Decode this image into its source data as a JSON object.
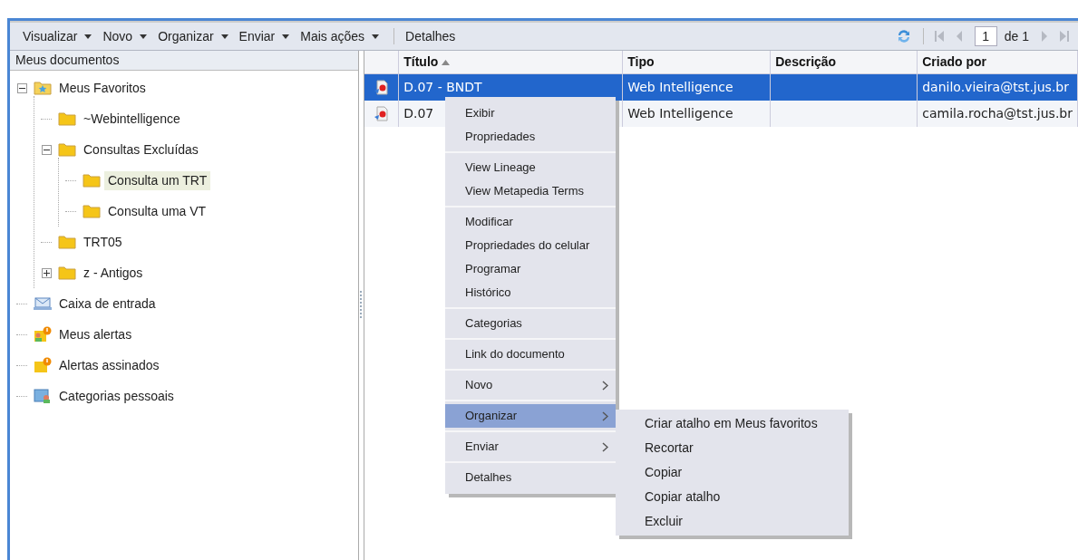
{
  "toolbar": {
    "menus": [
      {
        "label": "Visualizar",
        "dropdown": true
      },
      {
        "label": "Novo",
        "dropdown": true
      },
      {
        "label": "Organizar",
        "dropdown": true
      },
      {
        "label": "Enviar",
        "dropdown": true
      },
      {
        "label": "Mais ações",
        "dropdown": true
      },
      {
        "label": "Detalhes",
        "dropdown": false
      }
    ],
    "pager": {
      "page": "1",
      "of": "de 1"
    }
  },
  "sidebar": {
    "title": "Meus documentos",
    "items": [
      {
        "label": "Meus Favoritos",
        "kind": "favorites",
        "expanded": true,
        "selected": false,
        "children": [
          {
            "label": "~Webintelligence",
            "kind": "folder",
            "selected": false
          },
          {
            "label": "Consultas Excluídas",
            "kind": "folder",
            "expanded": true,
            "selected": false,
            "children": [
              {
                "label": "Consulta um TRT",
                "kind": "folder",
                "selected": true
              },
              {
                "label": "Consulta uma VT",
                "kind": "folder",
                "selected": false
              }
            ]
          },
          {
            "label": "TRT05",
            "kind": "folder",
            "selected": false
          },
          {
            "label": "z - Antigos",
            "kind": "folder",
            "expanded": false,
            "selected": false
          }
        ]
      },
      {
        "label": "Caixa de entrada",
        "kind": "inbox",
        "selected": false
      },
      {
        "label": "Meus alertas",
        "kind": "alerts",
        "selected": false
      },
      {
        "label": "Alertas assinados",
        "kind": "subscribed",
        "selected": false
      },
      {
        "label": "Categorias pessoais",
        "kind": "categories",
        "selected": false
      }
    ]
  },
  "table": {
    "columns": [
      {
        "label": "Título",
        "sorted_ascending": true
      },
      {
        "label": "Tipo"
      },
      {
        "label": "Descrição"
      },
      {
        "label": "Criado por"
      }
    ],
    "rows": [
      {
        "title": "D.07 - BNDT",
        "type": "Web Intelligence",
        "description": "",
        "created_by": "danilo.vieira@tst.jus.br",
        "selected": true
      },
      {
        "title": "D.07",
        "type": "Web Intelligence",
        "description": "",
        "created_by": "camila.rocha@tst.jus.br",
        "selected": false
      }
    ]
  },
  "context_menu": {
    "groups": [
      [
        {
          "label": "Exibir",
          "submenu": false,
          "selected": false
        },
        {
          "label": "Propriedades",
          "submenu": false,
          "selected": false
        }
      ],
      [
        {
          "label": "View Lineage",
          "submenu": false,
          "selected": false
        },
        {
          "label": "View Metapedia Terms",
          "submenu": false,
          "selected": false
        }
      ],
      [
        {
          "label": "Modificar",
          "submenu": false,
          "selected": false
        },
        {
          "label": "Propriedades do celular",
          "submenu": false,
          "selected": false
        },
        {
          "label": "Programar",
          "submenu": false,
          "selected": false
        },
        {
          "label": "Histórico",
          "submenu": false,
          "selected": false
        }
      ],
      [
        {
          "label": "Categorias",
          "submenu": false,
          "selected": false
        }
      ],
      [
        {
          "label": "Link do documento",
          "submenu": false,
          "selected": false
        }
      ],
      [
        {
          "label": "Novo",
          "submenu": true,
          "selected": false
        }
      ],
      [
        {
          "label": "Organizar",
          "submenu": true,
          "selected": true
        }
      ],
      [
        {
          "label": "Enviar",
          "submenu": true,
          "selected": false
        }
      ],
      [
        {
          "label": "Detalhes",
          "submenu": false,
          "selected": false
        }
      ]
    ],
    "submenu": [
      "Criar atalho em Meus favoritos",
      "Recortar",
      "Copiar",
      "Copiar atalho",
      "Excluir"
    ]
  }
}
